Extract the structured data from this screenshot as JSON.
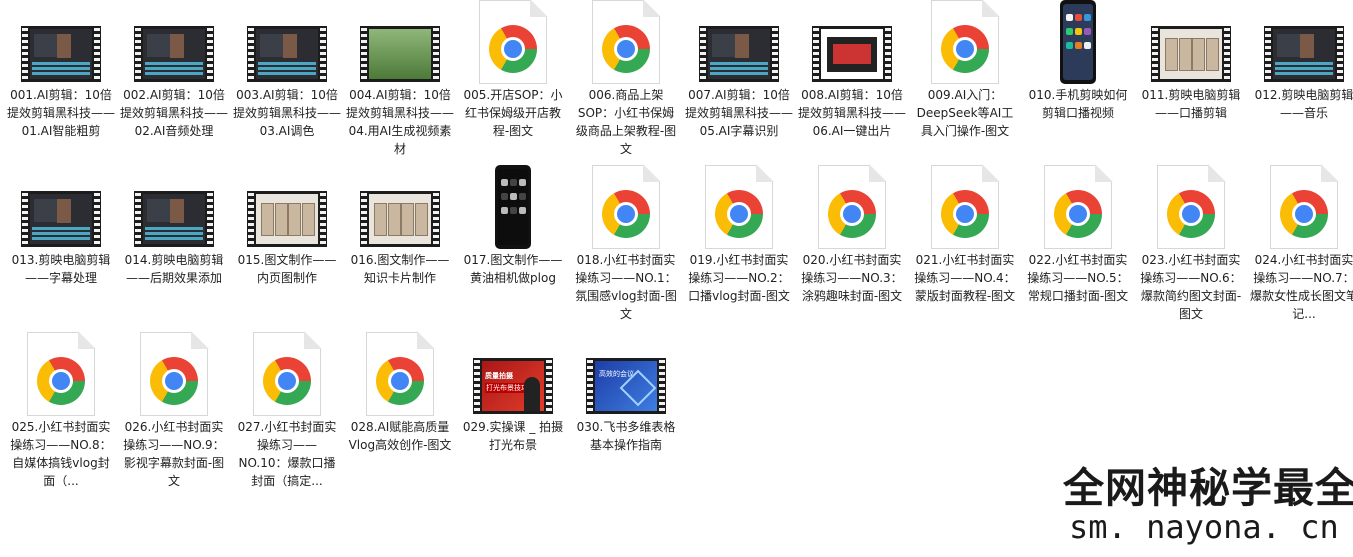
{
  "files": [
    {
      "label": "001.AI剪辑：10倍提效剪辑黑科技——01.AI智能粗剪",
      "icon": "video-thumbnail-icon"
    },
    {
      "label": "002.AI剪辑：10倍提效剪辑黑科技——02.AI音频处理",
      "icon": "video-thumbnail-icon"
    },
    {
      "label": "003.AI剪辑：10倍提效剪辑黑科技——03.AI调色",
      "icon": "video-thumbnail-icon"
    },
    {
      "label": "004.AI剪辑：10倍提效剪辑黑科技——04.用AI生成视频素材",
      "icon": "video-thumbnail-icon"
    },
    {
      "label": "005.开店SOP：小红书保姆级开店教程-图文",
      "icon": "chrome-html-icon"
    },
    {
      "label": "006.商品上架SOP：小红书保姆级商品上架教程-图文",
      "icon": "chrome-html-icon"
    },
    {
      "label": "007.AI剪辑：10倍提效剪辑黑科技——05.AI字幕识别",
      "icon": "video-thumbnail-icon"
    },
    {
      "label": "008.AI剪辑：10倍提效剪辑黑科技——06.AI一键出片",
      "icon": "video-thumbnail-icon"
    },
    {
      "label": "009.AI入门：DeepSeek等AI工具入门操作-图文",
      "icon": "chrome-html-icon"
    },
    {
      "label": "010.手机剪映如何剪辑口播视频",
      "icon": "phone-image-icon"
    },
    {
      "label": "011.剪映电脑剪辑——口播剪辑",
      "icon": "video-thumbnail-icon"
    },
    {
      "label": "012.剪映电脑剪辑——音乐",
      "icon": "video-thumbnail-icon"
    },
    {
      "label": "013.剪映电脑剪辑——字幕处理",
      "icon": "video-thumbnail-icon"
    },
    {
      "label": "014.剪映电脑剪辑——后期效果添加",
      "icon": "video-thumbnail-icon"
    },
    {
      "label": "015.图文制作——内页图制作",
      "icon": "video-thumbnail-icon"
    },
    {
      "label": "016.图文制作——知识卡片制作",
      "icon": "video-thumbnail-icon"
    },
    {
      "label": "017.图文制作——黄油相机做plog",
      "icon": "phone-image-icon"
    },
    {
      "label": "018.小红书封面实操练习——NO.1：氛围感vlog封面-图文",
      "icon": "chrome-html-icon"
    },
    {
      "label": "019.小红书封面实操练习——NO.2：口播vlog封面-图文",
      "icon": "chrome-html-icon"
    },
    {
      "label": "020.小红书封面实操练习——NO.3：涂鸦趣味封面-图文",
      "icon": "chrome-html-icon"
    },
    {
      "label": "021.小红书封面实操练习——NO.4：蒙版封面教程-图文",
      "icon": "chrome-html-icon"
    },
    {
      "label": "022.小红书封面实操练习——NO.5：常规口播封面-图文",
      "icon": "chrome-html-icon"
    },
    {
      "label": "023.小红书封面实操练习——NO.6：爆款简约图文封面-图文",
      "icon": "chrome-html-icon"
    },
    {
      "label": "024.小红书封面实操练习——NO.7：爆款女性成长图文笔记...",
      "icon": "chrome-html-icon"
    },
    {
      "label": "025.小红书封面实操练习——NO.8：自媒体搞钱vlog封面（...",
      "icon": "chrome-html-icon"
    },
    {
      "label": "026.小红书封面实操练习——NO.9：影视字幕款封面-图文",
      "icon": "chrome-html-icon"
    },
    {
      "label": "027.小红书封面实操练习——NO.10：爆款口播封面（搞定...",
      "icon": "chrome-html-icon"
    },
    {
      "label": "028.AI赋能高质量Vlog高效创作-图文",
      "icon": "chrome-html-icon"
    },
    {
      "label": "029.实操课 _ 拍摄打光布景",
      "icon": "video-thumbnail-icon"
    },
    {
      "label": "030.飞书多维表格基本操作指南",
      "icon": "video-thumbnail-icon"
    }
  ],
  "thumb_text": {
    "f029_line1": "质量拍摄",
    "f029_line2": "打光布景技巧",
    "f030_line1": "高效的会议"
  },
  "watermark": {
    "line1": "全网神秘学最全",
    "line2": "sm. nayona. cn"
  },
  "colors": {
    "chrome_red": "#ea4335",
    "chrome_green": "#34a853",
    "chrome_yellow": "#fbbc05",
    "chrome_blue": "#4285f4",
    "film": "#1c1c1c",
    "text": "#222222"
  }
}
